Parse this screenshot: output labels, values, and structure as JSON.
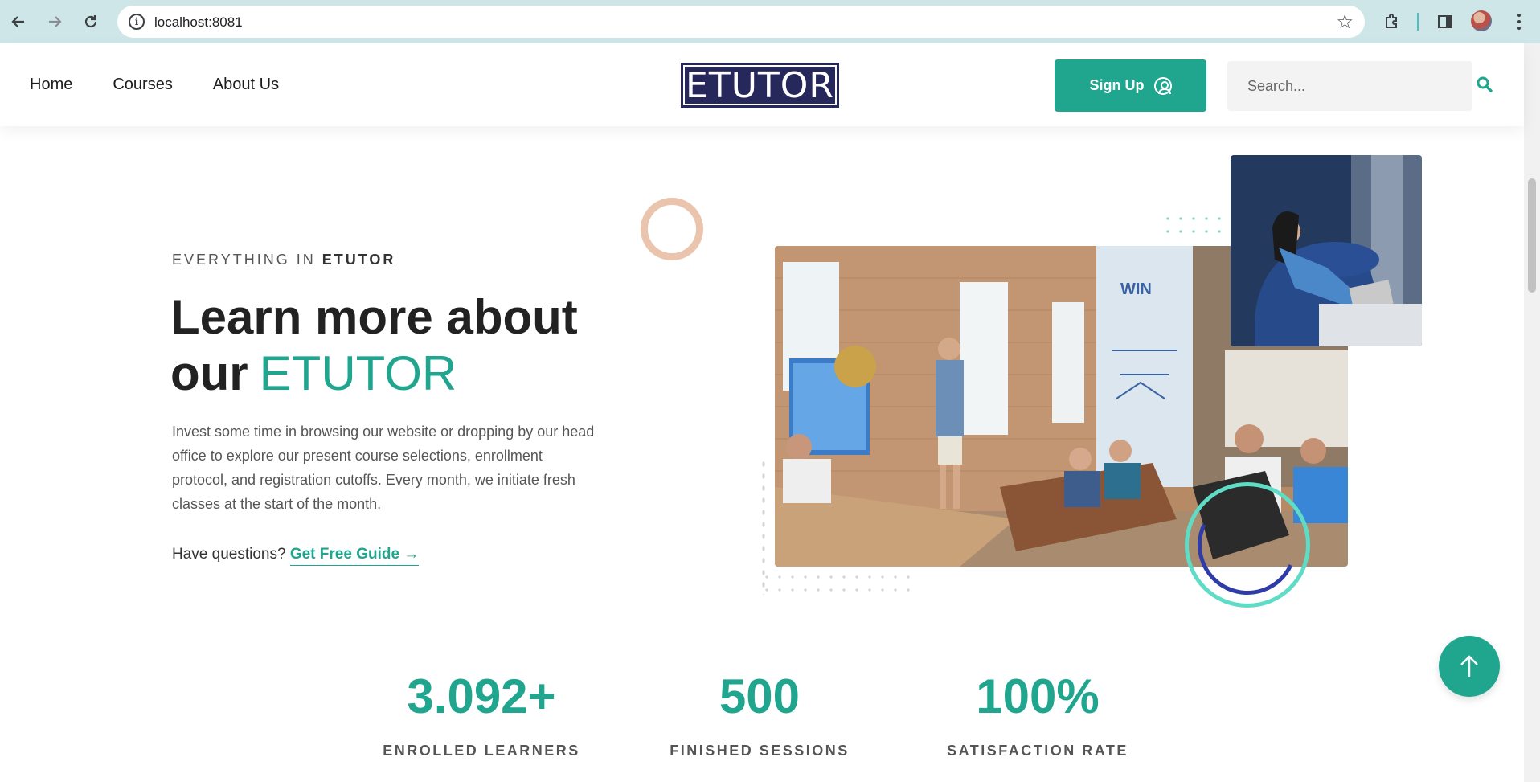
{
  "browser": {
    "url": "localhost:8081"
  },
  "nav": {
    "items": [
      {
        "label": "Home"
      },
      {
        "label": "Courses"
      },
      {
        "label": "About Us"
      }
    ]
  },
  "header": {
    "logo_text": "ETUTOR",
    "signup_label": "Sign Up",
    "search_placeholder": "Search..."
  },
  "hero": {
    "eyebrow_prefix": "EVERYTHING IN",
    "eyebrow_brand": "ETUTOR",
    "title_line1": "Learn more about",
    "title_line2_prefix": "our",
    "title_accent": "ETUTOR",
    "description": "Invest some time in browsing our website or dropping by our head office to explore our present course selections, enrollment protocol, and registration cutoffs. Every month, we initiate fresh classes at the start of the month.",
    "question": "Have questions?",
    "guide_link": "Get Free Guide →"
  },
  "stats": [
    {
      "value": "3.092+",
      "label": "ENROLLED LEARNERS"
    },
    {
      "value": "500",
      "label": "FINISHED SESSIONS"
    },
    {
      "value": "100%",
      "label": "SATISFACTION RATE"
    }
  ],
  "colors": {
    "accent": "#20a68e",
    "logo_bg": "#26275a",
    "chrome_bg": "#cfe6e8"
  },
  "icons": {
    "back": "arrow-left-icon",
    "forward": "arrow-right-icon",
    "reload": "reload-icon",
    "site_info": "info-icon",
    "bookmark": "star-icon",
    "extensions": "puzzle-icon",
    "side_panel": "side-panel-icon",
    "menu": "kebab-menu-icon",
    "signup": "user-circle-icon",
    "search": "search-icon",
    "to_top": "arrow-up-icon"
  }
}
